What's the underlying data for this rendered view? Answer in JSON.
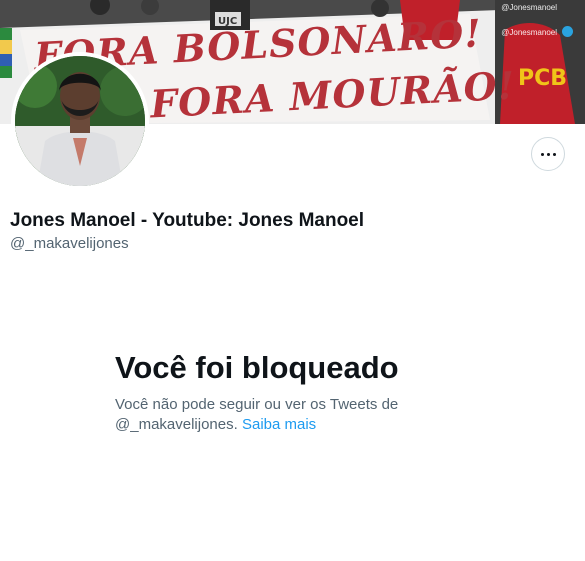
{
  "banner": {
    "watermark": "@Jonesmanoel",
    "watermark_secondary": "@Jonesmanoel",
    "line1": "FORA BOLSONARO!",
    "line2": "FORA MOURÃO!",
    "sign_initials": "UJC",
    "party_initials": "PCB"
  },
  "profile": {
    "display_name": "Jones Manoel - Youtube: Jones Manoel",
    "username": "@_makavelijones"
  },
  "more_button": {
    "icon": "more-horizontal-icon"
  },
  "blocked": {
    "title": "Você foi bloqueado",
    "message_part1": "Você não pode seguir ou ver os Tweets de",
    "message_handle": "@_makavelijones.",
    "learn_more": "Saiba mais"
  },
  "colors": {
    "text_primary": "#0f1419",
    "text_secondary": "#536471",
    "link": "#1d9bf0",
    "banner_red": "#b5323a"
  }
}
